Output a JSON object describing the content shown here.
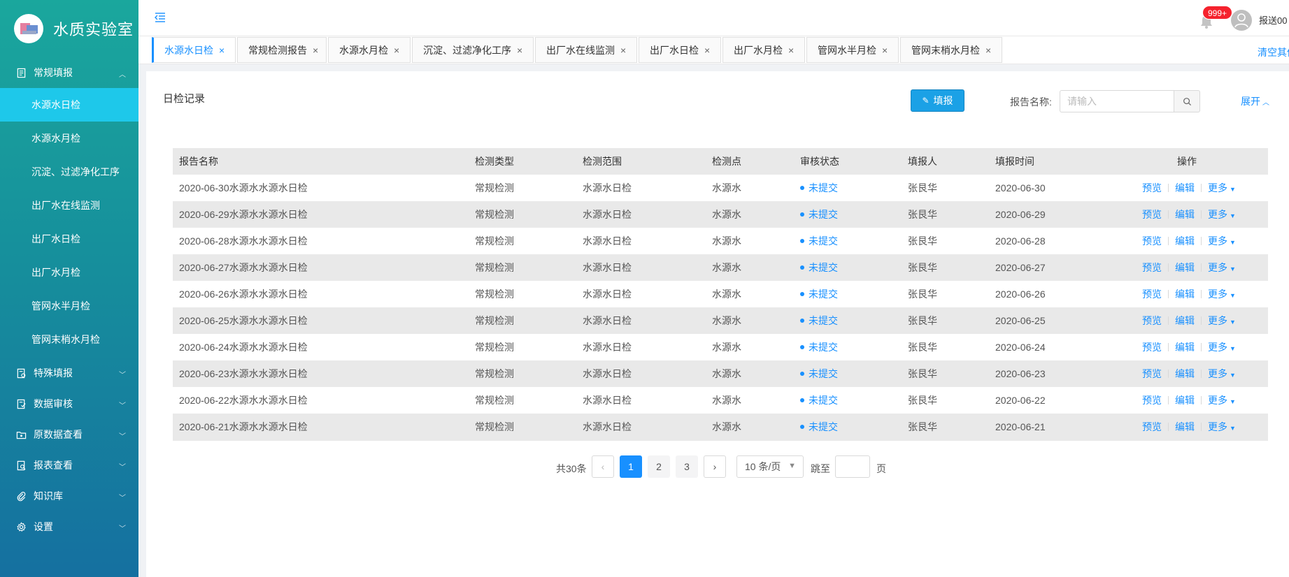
{
  "app": {
    "title": "水质实验室"
  },
  "sidebar": {
    "groups": [
      {
        "label": "常规填报",
        "expanded": true,
        "icon": "document-icon",
        "items": [
          {
            "label": "水源水日检",
            "active": true
          },
          {
            "label": "水源水月检"
          },
          {
            "label": "沉淀、过滤净化工序"
          },
          {
            "label": "出厂水在线监测"
          },
          {
            "label": "出厂水日检"
          },
          {
            "label": "出厂水月检"
          },
          {
            "label": "管网水半月检"
          },
          {
            "label": "管网末梢水月检"
          }
        ]
      },
      {
        "label": "特殊填报",
        "icon": "special-report-icon"
      },
      {
        "label": "数据审核",
        "icon": "audit-icon"
      },
      {
        "label": "原数据查看",
        "icon": "folder-icon"
      },
      {
        "label": "报表查看",
        "icon": "report-search-icon"
      },
      {
        "label": "知识库",
        "icon": "paperclip-icon"
      },
      {
        "label": "设置",
        "icon": "gear-icon"
      }
    ]
  },
  "header": {
    "badge": "999+",
    "username": "报送00"
  },
  "tabs": [
    {
      "label": "水源水日检",
      "active": true
    },
    {
      "label": "常规检测报告"
    },
    {
      "label": "水源水月检"
    },
    {
      "label": "沉淀、过滤净化工序"
    },
    {
      "label": "出厂水在线监测"
    },
    {
      "label": "出厂水日检"
    },
    {
      "label": "出厂水月检"
    },
    {
      "label": "管网水半月检"
    },
    {
      "label": "管网末梢水月检"
    }
  ],
  "tabs_clear": "清空其他",
  "main": {
    "title": "日检记录",
    "fill_button": "填报",
    "search_label": "报告名称:",
    "search_placeholder": "请输入",
    "expand_label": "展开"
  },
  "table": {
    "columns": [
      "报告名称",
      "检测类型",
      "检测范围",
      "检测点",
      "审核状态",
      "填报人",
      "填报时间",
      "操作"
    ],
    "rows": [
      {
        "name": "2020-06-30水源水水源水日检",
        "type": "常规检测",
        "scope": "水源水日检",
        "point": "水源水",
        "status": "未提交",
        "reporter": "张艮华",
        "date": "2020-06-30"
      },
      {
        "name": "2020-06-29水源水水源水日检",
        "type": "常规检测",
        "scope": "水源水日检",
        "point": "水源水",
        "status": "未提交",
        "reporter": "张艮华",
        "date": "2020-06-29"
      },
      {
        "name": "2020-06-28水源水水源水日检",
        "type": "常规检测",
        "scope": "水源水日检",
        "point": "水源水",
        "status": "未提交",
        "reporter": "张艮华",
        "date": "2020-06-28"
      },
      {
        "name": "2020-06-27水源水水源水日检",
        "type": "常规检测",
        "scope": "水源水日检",
        "point": "水源水",
        "status": "未提交",
        "reporter": "张艮华",
        "date": "2020-06-27"
      },
      {
        "name": "2020-06-26水源水水源水日检",
        "type": "常规检测",
        "scope": "水源水日检",
        "point": "水源水",
        "status": "未提交",
        "reporter": "张艮华",
        "date": "2020-06-26"
      },
      {
        "name": "2020-06-25水源水水源水日检",
        "type": "常规检测",
        "scope": "水源水日检",
        "point": "水源水",
        "status": "未提交",
        "reporter": "张艮华",
        "date": "2020-06-25"
      },
      {
        "name": "2020-06-24水源水水源水日检",
        "type": "常规检测",
        "scope": "水源水日检",
        "point": "水源水",
        "status": "未提交",
        "reporter": "张艮华",
        "date": "2020-06-24"
      },
      {
        "name": "2020-06-23水源水水源水日检",
        "type": "常规检测",
        "scope": "水源水日检",
        "point": "水源水",
        "status": "未提交",
        "reporter": "张艮华",
        "date": "2020-06-23"
      },
      {
        "name": "2020-06-22水源水水源水日检",
        "type": "常规检测",
        "scope": "水源水日检",
        "point": "水源水",
        "status": "未提交",
        "reporter": "张艮华",
        "date": "2020-06-22"
      },
      {
        "name": "2020-06-21水源水水源水日检",
        "type": "常规检测",
        "scope": "水源水日检",
        "point": "水源水",
        "status": "未提交",
        "reporter": "张艮华",
        "date": "2020-06-21"
      }
    ],
    "actions": {
      "preview": "预览",
      "edit": "编辑",
      "more": "更多"
    }
  },
  "pagination": {
    "total": "共30条",
    "pages": [
      "1",
      "2",
      "3"
    ],
    "current": "1",
    "page_size": "10 条/页",
    "jump_label": "跳至",
    "page_suffix": "页"
  },
  "colors": {
    "accent": "#1890ff",
    "sidebar_active": "#1ec8ea",
    "badge": "#f5222d"
  }
}
